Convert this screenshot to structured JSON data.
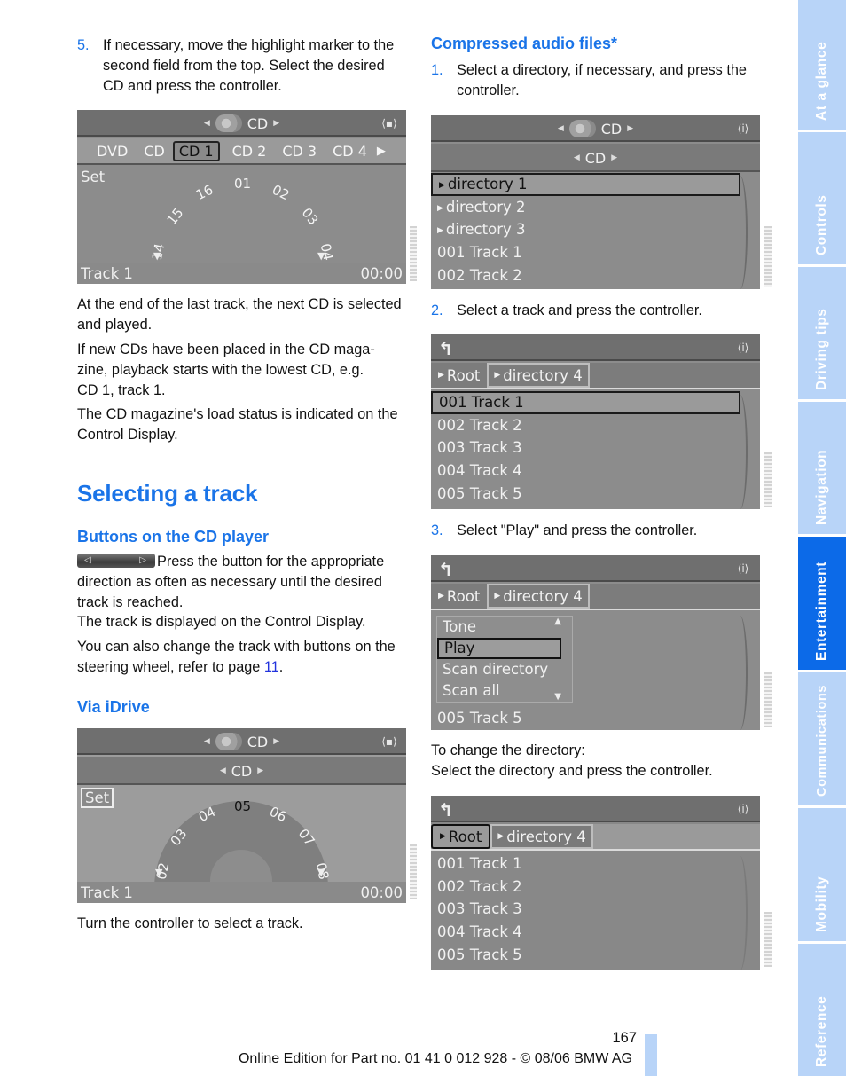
{
  "left_column": {
    "step5": {
      "num": "5.",
      "text": "If necessary, move the highlight marker to the second field from the top. Select the desired CD and press the controller."
    },
    "para1": "At the end of the last track, the next CD is selected and played.",
    "para2_line1": "If new CDs have been placed in the CD maga-",
    "para2_line2": "zine, playback starts with the lowest CD, e.g.",
    "para2_line3": "CD 1, track 1.",
    "para3": "The CD magazine's load status is indicated on the Control Display.",
    "section_title": "Selecting a track",
    "sub1": "Buttons on the CD player",
    "button_icon": "cd-player-track-button-icon",
    "sub1_text1": "Press the button for the appropriate direction as often as necessary until the desired track is reached.",
    "sub1_text2": "The track is displayed on the Control Display.",
    "sub1_text3_pre": "You can also change the track with buttons on the steering wheel, refer to page ",
    "sub1_text3_link": "11",
    "sub1_text3_post": ".",
    "sub2": "Via iDrive",
    "sub2_text": "Turn the controller to select a track."
  },
  "right_column": {
    "sub": "Compressed audio files*",
    "step1": {
      "num": "1.",
      "text": "Select a directory, if necessary, and press the controller."
    },
    "step2": {
      "num": "2.",
      "text": "Select a track and press the controller."
    },
    "step3": {
      "num": "3.",
      "text": "Select \"Play\" and press the controller."
    },
    "change_dir_1": "To change the directory:",
    "change_dir_2": "Select the directory and press the controller."
  },
  "screens": {
    "magazine": {
      "header": "CD",
      "tabs": [
        "DVD",
        "CD",
        "CD 1",
        "CD 2",
        "CD 3",
        "CD 4"
      ],
      "selected_tab": "CD 1",
      "set_label": "Set",
      "arc_numbers": [
        "14",
        "15",
        "16",
        "01",
        "02",
        "03",
        "04"
      ],
      "status_left": "Track 1",
      "status_right": "00:00"
    },
    "idrive": {
      "header": "CD",
      "sub_header": "CD",
      "set_label": "Set",
      "arc_numbers": [
        "02",
        "03",
        "04",
        "05",
        "06",
        "07",
        "08"
      ],
      "selected_number": "05",
      "status_left": "Track 1",
      "status_right": "00:00"
    },
    "dir_list": {
      "header": "CD",
      "sub_header": "CD",
      "items": [
        "directory 1",
        "directory 2",
        "directory 3",
        "001 Track 1",
        "002 Track 2"
      ],
      "selected_index": 0
    },
    "track_list": {
      "crumbs": [
        "Root",
        "directory 4"
      ],
      "items": [
        "001 Track 1",
        "002 Track 2",
        "003 Track 3",
        "004 Track 4",
        "005 Track 5"
      ],
      "selected_index": 0
    },
    "play_menu": {
      "crumbs": [
        "Root",
        "directory 4"
      ],
      "menu": [
        "Tone",
        "Play",
        "Scan directory",
        "Scan all"
      ],
      "selected_index": 1,
      "below": "005 Track 5"
    },
    "root_select": {
      "crumbs": [
        "Root",
        "directory 4"
      ],
      "selected_crumb": "Root",
      "items": [
        "001 Track 1",
        "002 Track 2",
        "003 Track 3",
        "004 Track 4",
        "005 Track 5"
      ]
    }
  },
  "side_tabs": [
    {
      "label": "At a glance",
      "active": false
    },
    {
      "label": "Controls",
      "active": false
    },
    {
      "label": "Driving tips",
      "active": false
    },
    {
      "label": "Navigation",
      "active": false
    },
    {
      "label": "Entertainment",
      "active": true
    },
    {
      "label": "Communications",
      "active": false
    },
    {
      "label": "Mobility",
      "active": false
    },
    {
      "label": "Reference",
      "active": false
    }
  ],
  "footer": {
    "page_number": "167",
    "edition": "Online Edition for Part no. 01 41 0 012 928 - © 08/06 BMW AG"
  },
  "colors": {
    "accent": "#1a74e8",
    "side_tab": "#b8d4f8",
    "side_tab_active": "#0c6ae8"
  }
}
